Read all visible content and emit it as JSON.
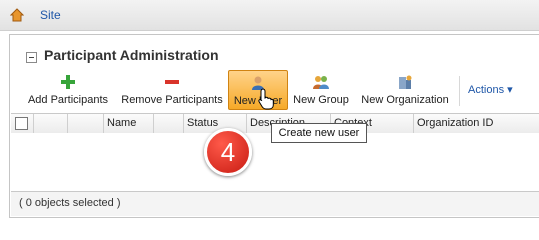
{
  "topbar": {
    "site_label": "Site"
  },
  "panel": {
    "title": "Participant Administration"
  },
  "toolbar": {
    "add_participants": "Add Participants",
    "remove_participants": "Remove Participants",
    "new_user": "New User",
    "new_group": "New Group",
    "new_organization": "New Organization",
    "actions": "Actions ▾"
  },
  "grid": {
    "columns": [
      "Name",
      "Status",
      "Description",
      "Context",
      "Organization ID"
    ]
  },
  "footer": {
    "selection": "( 0 objects selected )"
  },
  "tooltip": {
    "text": "Create new user"
  },
  "badge": {
    "step": "4"
  },
  "colors": {
    "link": "#1f57a8",
    "hover": "#f6a928",
    "badge": "#c81b12"
  },
  "icons": [
    "home-icon",
    "plus-icon",
    "minus-icon",
    "user-icon",
    "group-icon",
    "organization-icon",
    "hand-cursor-icon"
  ]
}
